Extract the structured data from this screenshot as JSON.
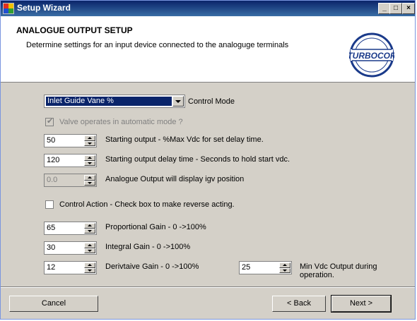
{
  "window": {
    "title": "Setup Wizard"
  },
  "titlebar_buttons": {
    "minimize": "_",
    "maximize": "□",
    "close": "×"
  },
  "header": {
    "title": "ANALOGUE OUTPUT SETUP",
    "subtitle": "Determine settings for an input device connected to the analoguge terminals",
    "logo_text": "TURBOCOR"
  },
  "control_mode": {
    "selected": "Inlet Guide Vane %",
    "label": "Control Mode"
  },
  "auto_mode": {
    "label": "Valve operates in automatic mode ?",
    "checked": true,
    "enabled": false
  },
  "starting_output": {
    "value": "50",
    "label": "Starting output - %Max Vdc for set delay time."
  },
  "start_delay": {
    "value": "120",
    "label": "Starting output delay time - Seconds to hold start vdc."
  },
  "igv_display": {
    "value": "0.0",
    "label": "Analogue Output will display igv position"
  },
  "control_action": {
    "label": "Control Action - Check box to make reverse acting.",
    "checked": false
  },
  "proportional_gain": {
    "value": "65",
    "label": "Proportional Gain - 0 ->100%"
  },
  "integral_gain": {
    "value": "30",
    "label": "Integral Gain - 0 ->100%"
  },
  "derivative_gain": {
    "value": "12",
    "label": "Derivtaive Gain - 0 ->100%"
  },
  "min_vdc": {
    "value": "25",
    "label": "Min Vdc Output during operation."
  },
  "buttons": {
    "cancel": "Cancel",
    "back": "< Back",
    "next": "Next >"
  }
}
